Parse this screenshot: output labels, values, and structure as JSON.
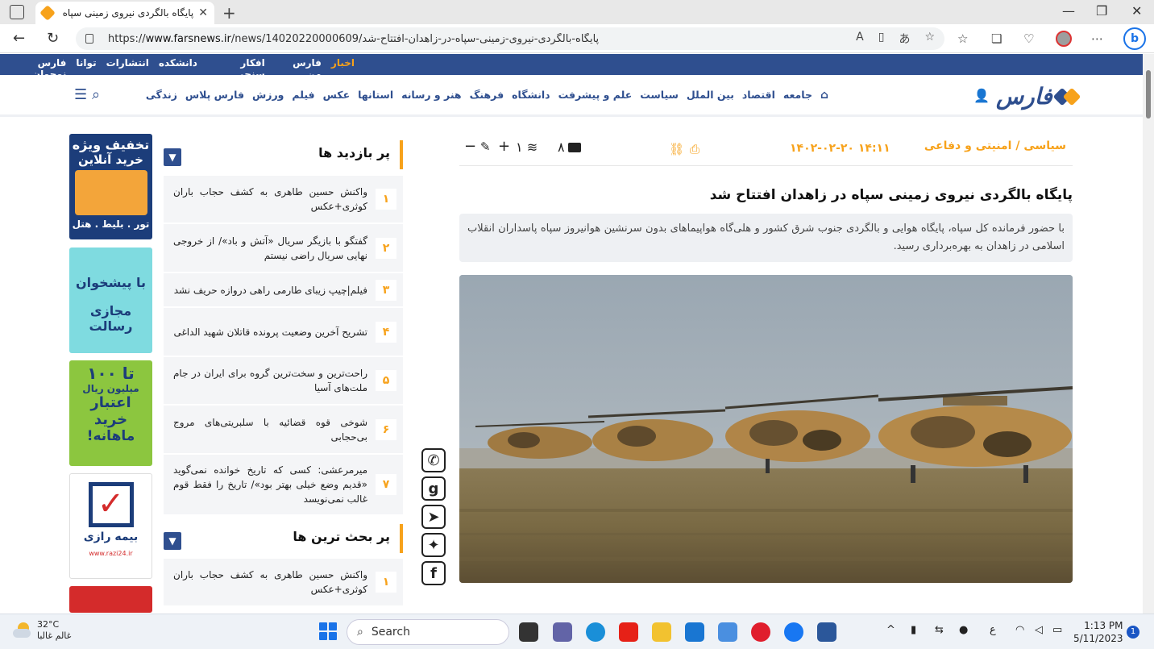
{
  "browser": {
    "tab_title": "پایگاه بالگردی نیروی زمینی سپاه در",
    "url_prefix": "https://",
    "url_domain": "www.farsnews.ir",
    "url_path": "/news/14020220000609/پایگاه-بالگردی-نیروی-زمینی-سپاه-در-زاهدان-افتتاح-شد"
  },
  "topbar": {
    "links": [
      "اخبار",
      "فارس من",
      "افکار سنجی",
      "دانشکده",
      "انتشارات",
      "توانا",
      "فارس نوجوان"
    ]
  },
  "nav": {
    "logo": "فارس",
    "links": [
      "جامعه",
      "اقتصاد",
      "بین الملل",
      "سیاست",
      "علم و پیشرفت",
      "دانشگاه",
      "فرهنگ",
      "هنر و رسانه",
      "استانها",
      "عکس",
      "فیلم",
      "ورزش",
      "فارس پلاس",
      "زندگی"
    ]
  },
  "article": {
    "category": "سیاسی / امنیتی و دفاعی",
    "datetime": "۱۴۰۲-۰۲-۲۰ ۱۴:۱۱",
    "comments": "۸",
    "shares": "۱",
    "title": "پایگاه بالگردی نیروی زمینی سپاه در زاهدان افتتاح شد",
    "lead": "با حضور فرمانده کل سپاه، پایگاه هوایی و بالگردی جنوب شرق کشور و هلی‌گاه هواپیماهای بدون سرنشین هوانیروز سپاه پاسداران انقلاب اسلامی در زاهدان به بهره‌برداری رسید."
  },
  "most_viewed": {
    "title": "پر بازدید ها",
    "items": [
      {
        "num": "۱",
        "text": "واکنش حسین طاهری به کشف حجاب باران کوثری+عکس"
      },
      {
        "num": "۲",
        "text": "گفتگو با بازیگر سریال «آتش و باد»/ از خروجی نهایی سریال راضی نیستم"
      },
      {
        "num": "۳",
        "text": "فیلم|چیپ زیبای طارمی راهی دروازه حریف نشد"
      },
      {
        "num": "۴",
        "text": "تشریح آخرین وضعیت پرونده قاتلان شهید الداغی"
      },
      {
        "num": "۵",
        "text": "راحت‌ترین و سخت‌ترین گروه برای ایران در جام ملت‌های آسیا"
      },
      {
        "num": "۶",
        "text": "شوخی قوه قضائیه با سلبریتی‌های مروج بی‌حجابی"
      },
      {
        "num": "۷",
        "text": "میرمرعشی: کسی که تاریخ خوانده نمی‌گوید «قدیم وضع خیلی بهتر بود»/ تاریخ را فقط قوم غالب نمی‌نویسد"
      }
    ]
  },
  "most_discussed": {
    "title": "پر بحث ترین ها",
    "items": [
      {
        "num": "۱",
        "text": "واکنش حسین طاهری به کشف حجاب باران کوثری+عکس"
      }
    ]
  },
  "ads": {
    "ad1_line1": "تخفیف ویژه",
    "ad1_line2": "خرید آنلاین",
    "ad1_line3": "تور . بلیط . هتل",
    "ad2_line1": "با پیشخوان",
    "ad2_line2": "مجازی رسالت",
    "ad3_line1": "تا ۱۰۰",
    "ad3_line2": "میلیون ریال",
    "ad3_line3": "اعتبار",
    "ad3_line4": "خرید",
    "ad3_line5": "ماهانه!",
    "ad4_name": "بیمه رازی",
    "ad4_url": "www.razi24.ir"
  },
  "taskbar": {
    "temp": "32°C",
    "weather_desc": "غالم غالبا",
    "search_placeholder": "Search",
    "time": "1:13 PM",
    "date": "5/11/2023",
    "notif_count": "1",
    "lang": "ع"
  },
  "colors": {
    "brand_blue": "#2f4f8f",
    "brand_orange": "#f7a21b"
  }
}
